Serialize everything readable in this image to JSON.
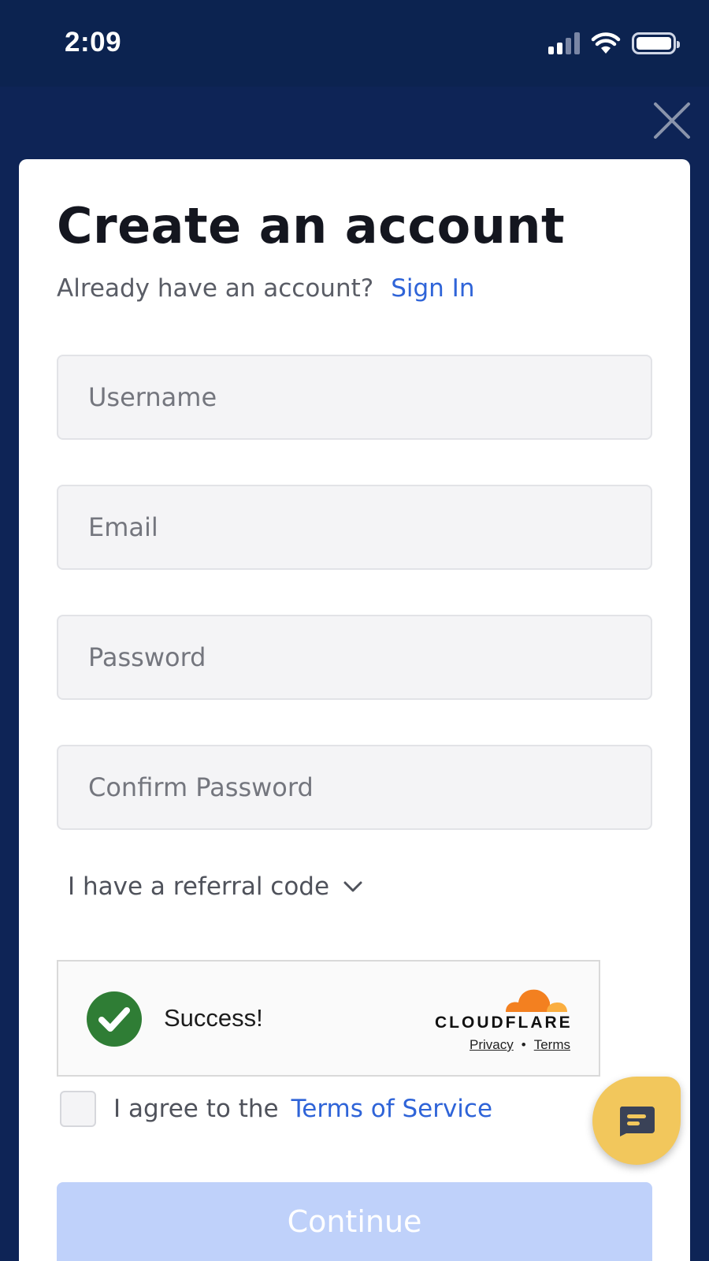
{
  "status_bar": {
    "time": "2:09",
    "signal_icon": "cellular-signal-icon",
    "wifi_icon": "wifi-icon",
    "battery_icon": "battery-icon"
  },
  "close_icon": "close-icon",
  "card": {
    "title": "Create an account",
    "signin_prompt": "Already have an account?",
    "signin_link": "Sign In"
  },
  "fields": {
    "username_placeholder": "Username",
    "email_placeholder": "Email",
    "password_placeholder": "Password",
    "confirm_password_placeholder": "Confirm Password"
  },
  "referral": {
    "label": "I have a referral code",
    "icon": "chevron-down-icon"
  },
  "captcha": {
    "status": "Success!",
    "brand": "CLOUDFLARE",
    "privacy_link": "Privacy",
    "separator": "•",
    "terms_link": "Terms"
  },
  "agree": {
    "text": "I agree to the",
    "tos_link": "Terms of Service",
    "checked": false
  },
  "continue_button": "Continue",
  "chat_icon": "chat-bubble-icon",
  "colors": {
    "background": "#0e2456",
    "link": "#2f64d8",
    "continue_disabled": "#bfd1fa",
    "success": "#2f7d35",
    "chat": "#f2c75c",
    "cloudflare_orange": "#f38020"
  }
}
